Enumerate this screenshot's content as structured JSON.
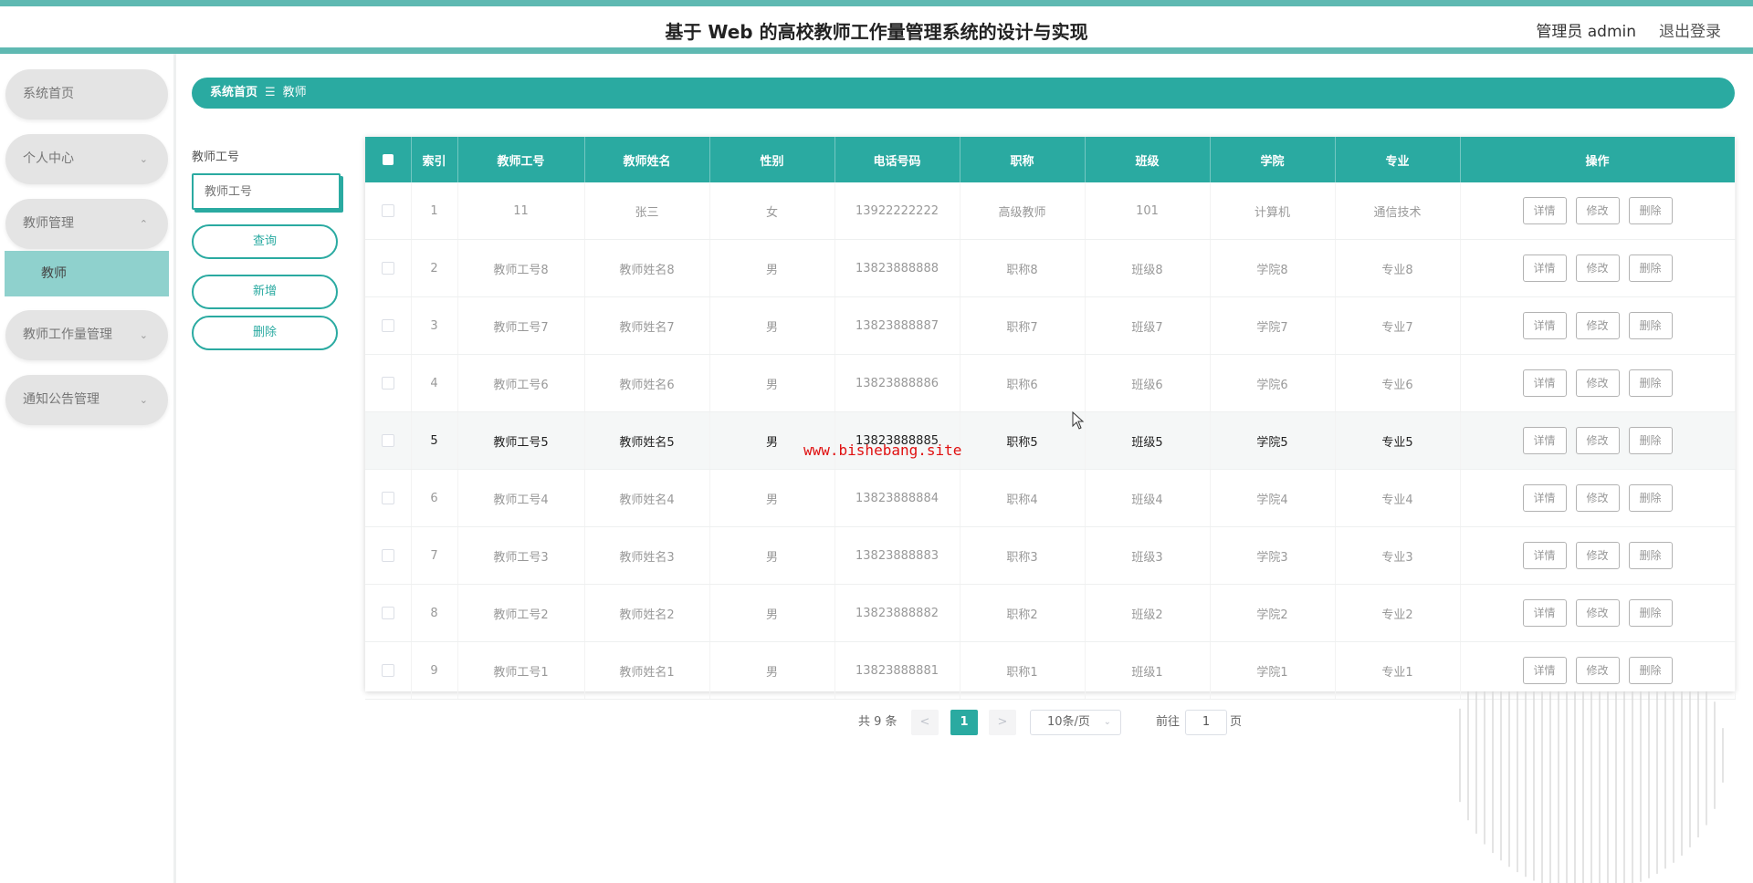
{
  "header": {
    "title": "基于 Web 的高校教师工作量管理系统的设计与实现",
    "user": "管理员 admin",
    "logout": "退出登录"
  },
  "sidebar": {
    "items": [
      {
        "label": "系统首页",
        "chevron": ""
      },
      {
        "label": "个人中心",
        "chevron": "⌄"
      },
      {
        "label": "教师管理",
        "chevron": "⌃"
      },
      {
        "label": "教师工作量管理",
        "chevron": "⌄"
      },
      {
        "label": "通知公告管理",
        "chevron": "⌄"
      }
    ],
    "active_sub": "教师"
  },
  "breadcrumb": {
    "home": "系统首页",
    "separator": "☰",
    "current": "教师"
  },
  "search": {
    "label": "教师工号",
    "placeholder": "教师工号",
    "query_button": "查询",
    "add_button": "新增",
    "delete_button": "删除"
  },
  "table": {
    "columns": [
      "索引",
      "教师工号",
      "教师姓名",
      "性别",
      "电话号码",
      "职称",
      "班级",
      "学院",
      "专业",
      "操作"
    ],
    "actions": {
      "detail": "详情",
      "edit": "修改",
      "delete": "删除"
    },
    "rows": [
      [
        "1",
        "11",
        "张三",
        "女",
        "13922222222",
        "高级教师",
        "101",
        "计算机",
        "通信技术"
      ],
      [
        "2",
        "教师工号8",
        "教师姓名8",
        "男",
        "13823888888",
        "职称8",
        "班级8",
        "学院8",
        "专业8"
      ],
      [
        "3",
        "教师工号7",
        "教师姓名7",
        "男",
        "13823888887",
        "职称7",
        "班级7",
        "学院7",
        "专业7"
      ],
      [
        "4",
        "教师工号6",
        "教师姓名6",
        "男",
        "13823888886",
        "职称6",
        "班级6",
        "学院6",
        "专业6"
      ],
      [
        "5",
        "教师工号5",
        "教师姓名5",
        "男",
        "13823888885",
        "职称5",
        "班级5",
        "学院5",
        "专业5"
      ],
      [
        "6",
        "教师工号4",
        "教师姓名4",
        "男",
        "13823888884",
        "职称4",
        "班级4",
        "学院4",
        "专业4"
      ],
      [
        "7",
        "教师工号3",
        "教师姓名3",
        "男",
        "13823888883",
        "职称3",
        "班级3",
        "学院3",
        "专业3"
      ],
      [
        "8",
        "教师工号2",
        "教师姓名2",
        "男",
        "13823888882",
        "职称2",
        "班级2",
        "学院2",
        "专业2"
      ],
      [
        "9",
        "教师工号1",
        "教师姓名1",
        "男",
        "13823888881",
        "职称1",
        "班级1",
        "学院1",
        "专业1"
      ]
    ],
    "highlighted_row": 4
  },
  "pagination": {
    "total": "共 9 条",
    "prev": "<",
    "current": "1",
    "next": ">",
    "page_size": "10条/页",
    "goto_label": "前往",
    "goto_value": "1",
    "page_suffix": "页"
  },
  "watermark": "www.bishebang.site",
  "colors": {
    "primary": "#2aaaa1",
    "stripe": "#5fb9b2",
    "active_menu": "#8fd1cd"
  }
}
